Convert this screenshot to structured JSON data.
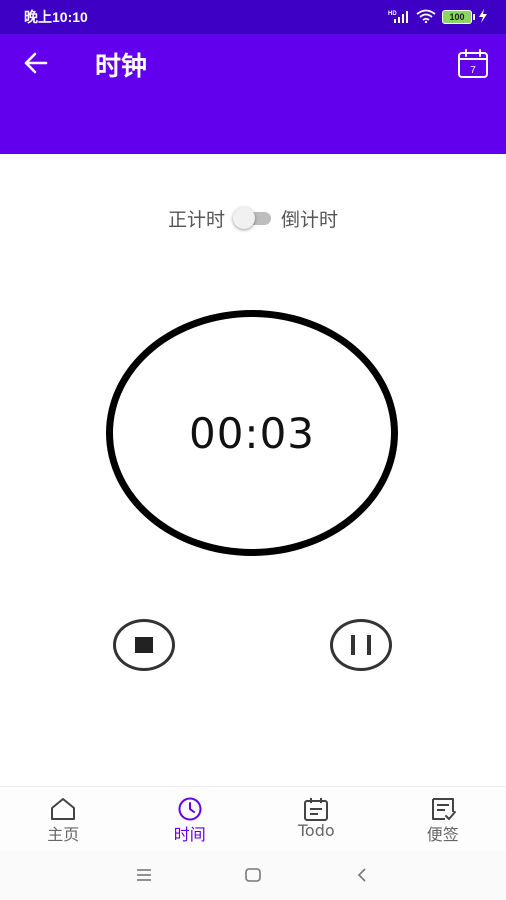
{
  "status_bar": {
    "time": "晚上10:10",
    "signal_label": "HD",
    "battery_level": "100",
    "icons": [
      "signal-icon",
      "wifi-icon",
      "battery-icon",
      "charging-icon"
    ]
  },
  "app_bar": {
    "title": "时钟",
    "back_icon": "back-arrow-icon",
    "calendar_icon": "calendar-icon",
    "calendar_day": "7",
    "color": "#6200ee"
  },
  "mode_switch": {
    "left_label": "正计时",
    "right_label": "倒计时",
    "checked": false
  },
  "timer": {
    "display": "00:03"
  },
  "controls": {
    "stop_icon": "stop-icon",
    "pause_icon": "pause-icon"
  },
  "bottom_nav": {
    "items": [
      {
        "label": "主页",
        "icon": "home-icon",
        "active": false
      },
      {
        "label": "时间",
        "icon": "clock-icon",
        "active": true
      },
      {
        "label": "Todo",
        "icon": "todo-calendar-icon",
        "active": false
      },
      {
        "label": "便签",
        "icon": "note-icon",
        "active": false
      }
    ],
    "active_color": "#6200ee"
  },
  "system_nav": {
    "icons": [
      "menu-icon",
      "home-square-icon",
      "back-chevron-icon"
    ]
  }
}
